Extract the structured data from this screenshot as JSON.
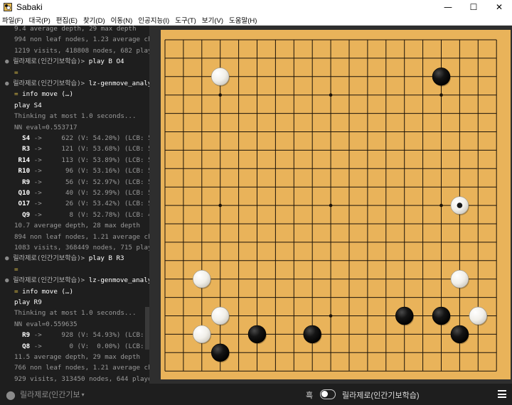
{
  "window": {
    "title": "Sabaki",
    "controls": {
      "minimize": "—",
      "maximize": "☐",
      "close": "✕"
    }
  },
  "menu": [
    "파일(F)",
    "대국(P)",
    "편집(E)",
    "찾기(D)",
    "이동(N)",
    "인공지능(I)",
    "도구(T)",
    "보기(V)",
    "도움말(H)"
  ],
  "console": {
    "lines": [
      {
        "t": "out",
        "text": "9.4 average depth, 29 max depth"
      },
      {
        "t": "out",
        "text": "994 non leaf nodes, 1.23 average children"
      },
      {
        "t": "out",
        "text": "1219 visits, 418808 nodes, 682 playouts"
      },
      {
        "t": "prompt",
        "engine": "릴라제로(인간기보학습)",
        "cmd": "play B O4"
      },
      {
        "t": "yellow",
        "text": "="
      },
      {
        "t": "prompt",
        "engine": "릴라제로(인간기보학습)",
        "cmd": "lz-genmove_analyze"
      },
      {
        "t": "info",
        "text": "info move (…)"
      },
      {
        "t": "cmd",
        "text": "play S4"
      },
      {
        "t": "out",
        "text": "Thinking at most 1.0 seconds..."
      },
      {
        "t": "out",
        "text": "NN eval=0.553717"
      },
      {
        "t": "move",
        "move": "S4",
        "rest": " ->     622 (V: 54.20%) (LCB: 5"
      },
      {
        "t": "move",
        "move": "R3",
        "rest": " ->     121 (V: 53.68%) (LCB: 5"
      },
      {
        "t": "move",
        "move": "R14",
        "rest": " ->     113 (V: 53.89%) (LCB: 5"
      },
      {
        "t": "move",
        "move": "R10",
        "rest": " ->      96 (V: 53.16%) (LCB: 5"
      },
      {
        "t": "move",
        "move": "R9",
        "rest": " ->      56 (V: 52.97%) (LCB: 5"
      },
      {
        "t": "move",
        "move": "Q10",
        "rest": " ->      40 (V: 52.99%) (LCB: 5"
      },
      {
        "t": "move",
        "move": "O17",
        "rest": " ->      26 (V: 53.42%) (LCB: 5"
      },
      {
        "t": "move",
        "move": "Q9",
        "rest": " ->       8 (V: 52.78%) (LCB: 4"
      },
      {
        "t": "out",
        "text": "10.7 average depth, 28 max depth"
      },
      {
        "t": "out",
        "text": "894 non leaf nodes, 1.21 average children"
      },
      {
        "t": "out",
        "text": "1083 visits, 368449 nodes, 715 playouts"
      },
      {
        "t": "prompt",
        "engine": "릴라제로(인간기보학습)",
        "cmd": "play B R3"
      },
      {
        "t": "yellow",
        "text": "="
      },
      {
        "t": "prompt",
        "engine": "릴라제로(인간기보학습)",
        "cmd": "lz-genmove_analyze"
      },
      {
        "t": "info",
        "text": "info move (…)"
      },
      {
        "t": "cmd",
        "text": "play R9"
      },
      {
        "t": "out",
        "text": "Thinking at most 1.0 seconds..."
      },
      {
        "t": "out",
        "text": "NN eval=0.559635"
      },
      {
        "t": "move",
        "move": "R9",
        "rest": " ->     928 (V: 54.93%) (LCB: 5"
      },
      {
        "t": "move",
        "move": "Q8",
        "rest": " ->       0 (V:  0.00%) (LCB:  "
      },
      {
        "t": "out",
        "text": "11.5 average depth, 29 max depth"
      },
      {
        "t": "out",
        "text": "766 non leaf nodes, 1.21 average children"
      },
      {
        "t": "out",
        "text": "929 visits, 313450 nodes, 644 playouts"
      }
    ],
    "input_engine": "릴라제로(인간기보"
  },
  "board": {
    "size": 19,
    "hoshi": [
      [
        3,
        3
      ],
      [
        9,
        3
      ],
      [
        15,
        3
      ],
      [
        3,
        9
      ],
      [
        9,
        9
      ],
      [
        15,
        9
      ],
      [
        3,
        15
      ],
      [
        9,
        15
      ],
      [
        15,
        15
      ]
    ],
    "stones": [
      {
        "color": "white",
        "col": 3,
        "row": 2
      },
      {
        "color": "black",
        "col": 15,
        "row": 2
      },
      {
        "color": "white",
        "col": 16,
        "row": 9,
        "last": true
      },
      {
        "color": "white",
        "col": 2,
        "row": 13
      },
      {
        "color": "white",
        "col": 16,
        "row": 13
      },
      {
        "color": "white",
        "col": 3,
        "row": 15
      },
      {
        "color": "black",
        "col": 13,
        "row": 15
      },
      {
        "color": "black",
        "col": 15,
        "row": 15
      },
      {
        "color": "white",
        "col": 17,
        "row": 15
      },
      {
        "color": "white",
        "col": 2,
        "row": 16
      },
      {
        "color": "black",
        "col": 5,
        "row": 16
      },
      {
        "color": "black",
        "col": 8,
        "row": 16
      },
      {
        "color": "black",
        "col": 16,
        "row": 16
      },
      {
        "color": "black",
        "col": 3,
        "row": 17
      }
    ]
  },
  "status": {
    "black_player": "흑",
    "white_player": "릴라제로(인간기보학습)"
  },
  "colors": {
    "board": "#e9b35a",
    "grid": "#1a1208",
    "console_bg": "#1e1e1e",
    "accent_yellow": "#e8c84a"
  }
}
